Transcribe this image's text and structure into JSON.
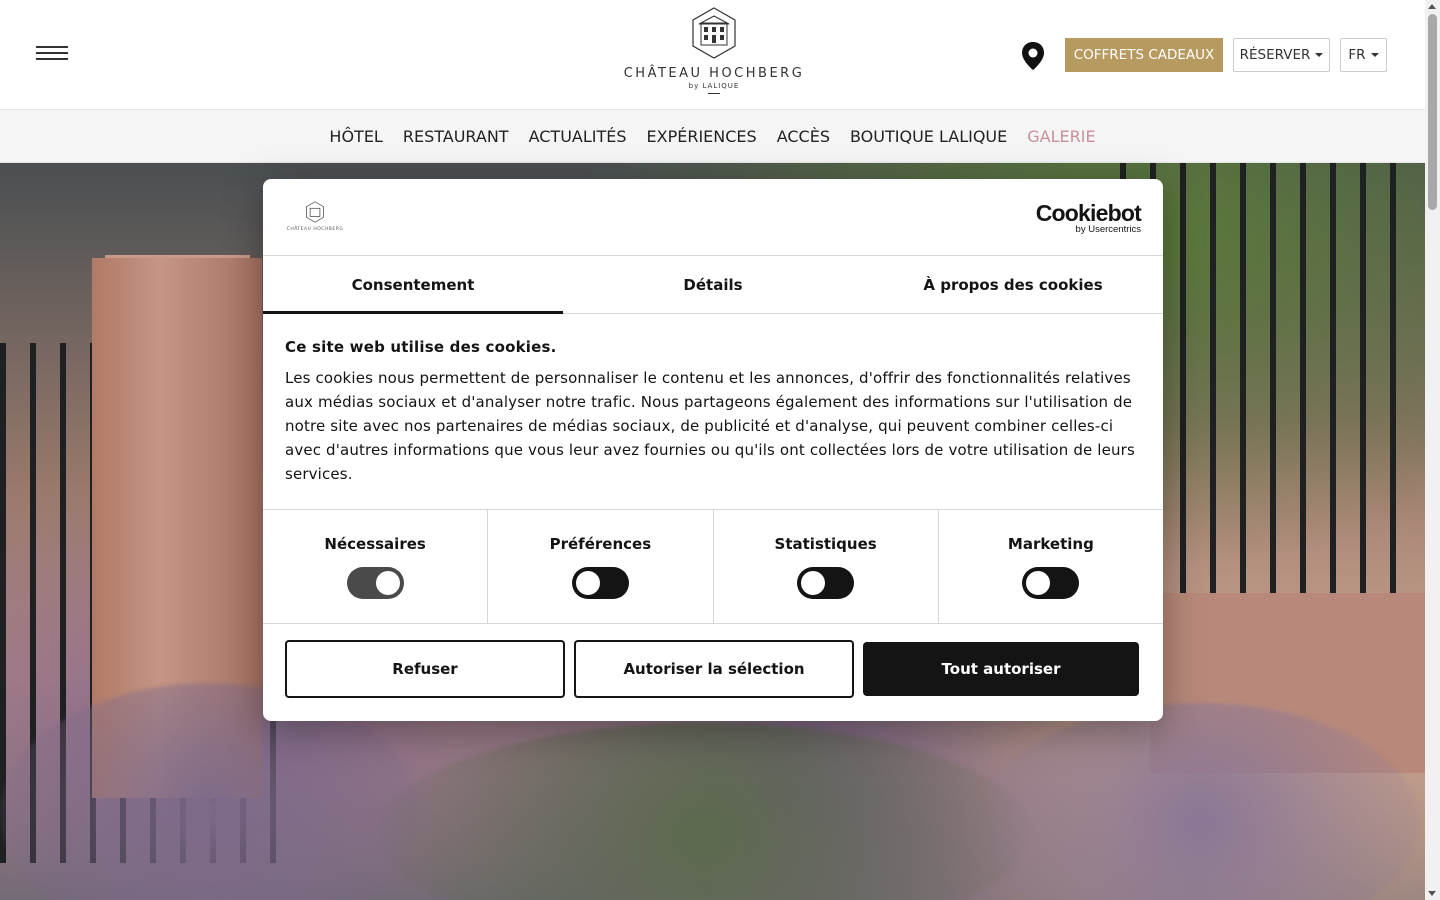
{
  "header": {
    "logo_name": "CHÂTEAU HOCHBERG",
    "logo_sub": "by LALIQUE",
    "gift_label": "COFFRETS CADEAUX",
    "reserve_label": "RÉSERVER",
    "lang_label": "FR",
    "gift_color": "#b79a5f"
  },
  "nav": {
    "items": [
      {
        "label": "HÔTEL"
      },
      {
        "label": "RESTAURANT"
      },
      {
        "label": "ACTUALITÉS"
      },
      {
        "label": "EXPÉRIENCES"
      },
      {
        "label": "ACCÈS"
      },
      {
        "label": "BOUTIQUE LALIQUE"
      },
      {
        "label": "GALERIE",
        "active": true
      }
    ],
    "active_color": "#c9909a"
  },
  "cookie_dialog": {
    "logo_text": "CHÂTEAU HOCHBERG",
    "brand": "Cookiebot",
    "brand_sub": "by Usercentrics",
    "tabs": [
      {
        "label": "Consentement",
        "active": true
      },
      {
        "label": "Détails"
      },
      {
        "label": "À propos des cookies"
      }
    ],
    "title": "Ce site web utilise des cookies.",
    "text": "Les cookies nous permettent de personnaliser le contenu et les annonces, d'offrir des fonctionnalités relatives aux médias sociaux et d'analyser notre trafic. Nous partageons également des informations sur l'utilisation de notre site avec nos partenaires de médias sociaux, de publicité et d'analyse, qui peuvent combiner celles-ci avec d'autres informations que vous leur avez fournies ou qu'ils ont collectées lors de votre utilisation de leurs services.",
    "toggles": [
      {
        "label": "Nécessaires",
        "on": true
      },
      {
        "label": "Préférences",
        "on": false
      },
      {
        "label": "Statistiques",
        "on": false
      },
      {
        "label": "Marketing",
        "on": false
      }
    ],
    "refuse_label": "Refuser",
    "allow_selection_label": "Autoriser la sélection",
    "allow_all_label": "Tout autoriser"
  }
}
